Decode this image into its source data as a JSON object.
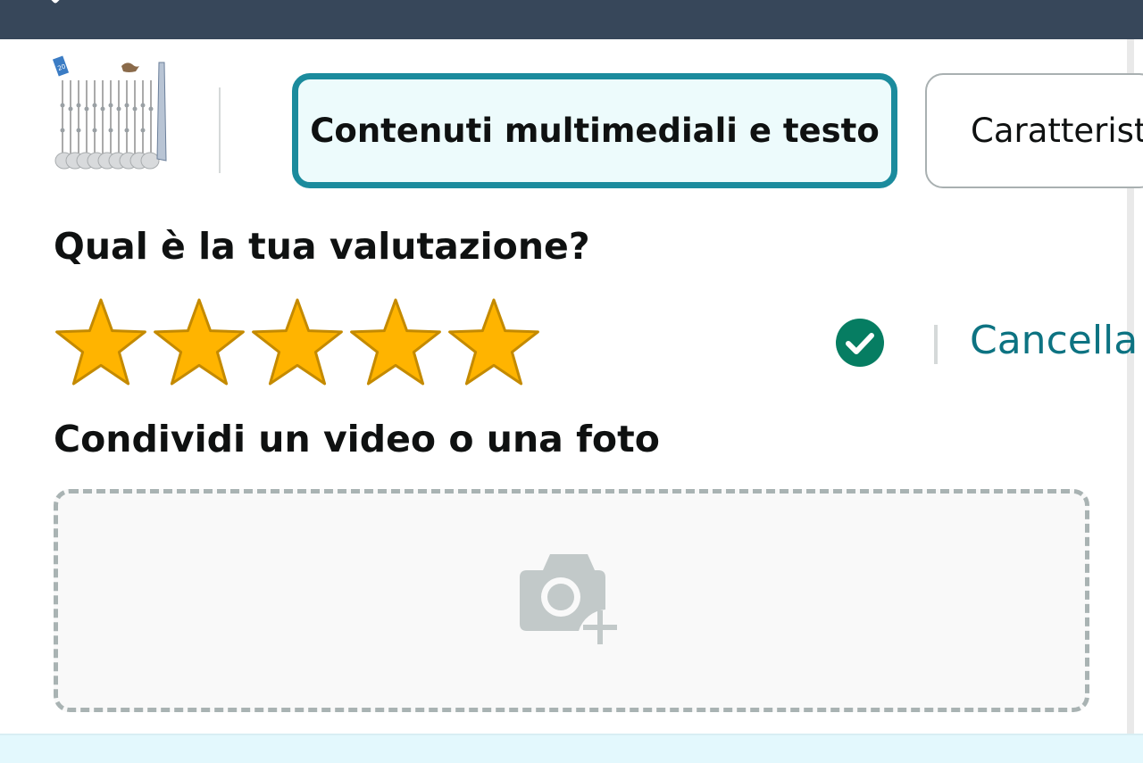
{
  "tabs": [
    {
      "label": "Contenuti multimediali e testo",
      "active": true
    },
    {
      "label": "Caratteristi",
      "active": false
    }
  ],
  "rating": {
    "heading": "Qual è la tua valutazione?",
    "stars_selected": 5,
    "stars_total": 5,
    "clear_label": "Cancella"
  },
  "media": {
    "heading": "Condividi un video o una foto"
  },
  "product_thumbnail": {
    "badge": "20"
  },
  "icons": {
    "back": "chevron-down-icon",
    "confirm": "check-circle-icon",
    "upload": "camera-add-icon"
  },
  "colors": {
    "topbar": "#37475a",
    "active_tab_border": "#1b8b9d",
    "active_tab_bg": "#edfbfc",
    "star_fill": "#ffb400",
    "star_stroke": "#c48a00",
    "check": "#067d62",
    "link": "#0d7382",
    "dashed_border": "#a9b3b3",
    "bottom_band": "#e3f8fd"
  }
}
